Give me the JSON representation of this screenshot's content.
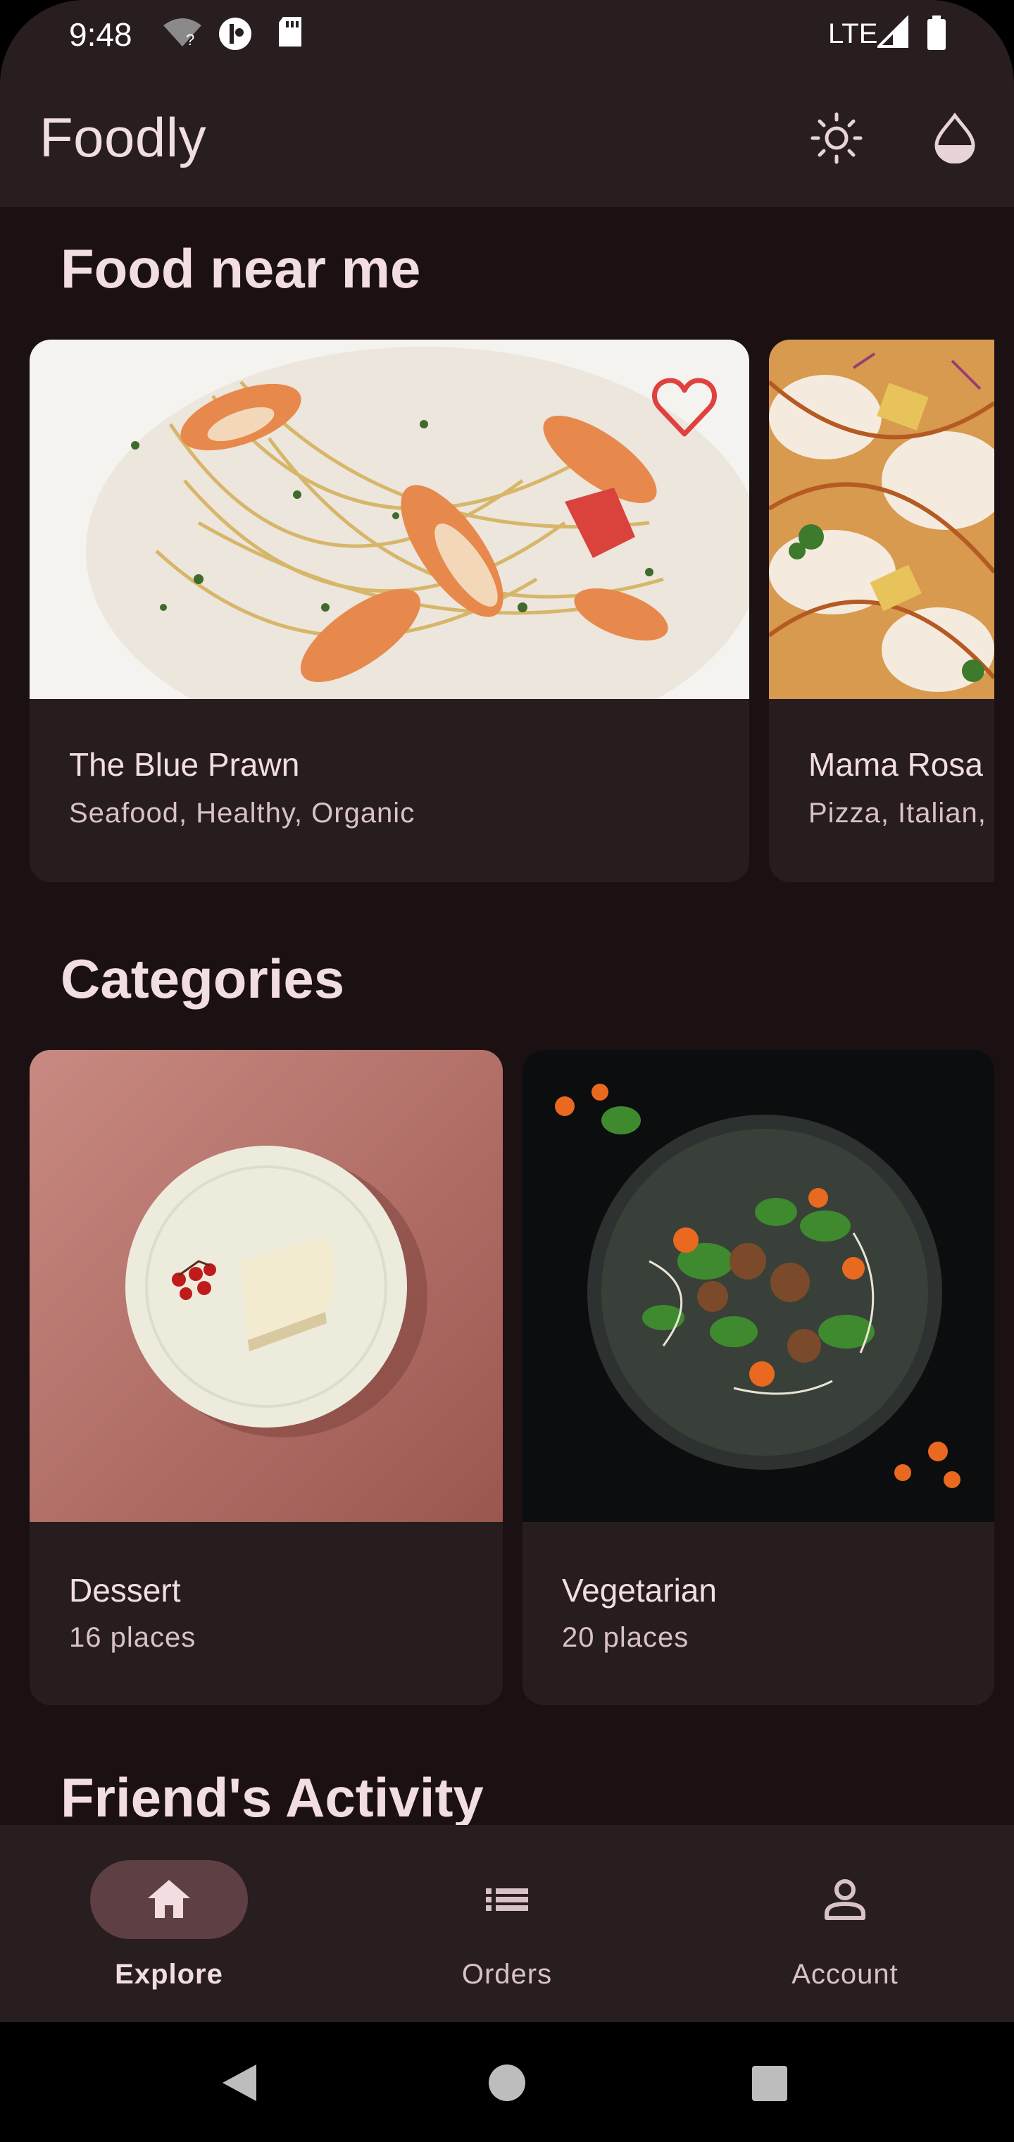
{
  "status_bar": {
    "time": "9:48",
    "network": "LTE"
  },
  "app_bar": {
    "title": "Foodly",
    "icons": [
      "brightness-icon",
      "water-drop-icon"
    ]
  },
  "sections": {
    "food_near_me": {
      "title": "Food near me",
      "restaurants": [
        {
          "name": "The Blue Prawn",
          "tags": "Seafood, Healthy, Organic",
          "favorite": true
        },
        {
          "name": "Mama Rosa",
          "tags": "Pizza, Italian,"
        }
      ]
    },
    "categories": {
      "title": "Categories",
      "items": [
        {
          "name": "Dessert",
          "count": "16 places"
        },
        {
          "name": "Vegetarian",
          "count": "20 places"
        }
      ]
    },
    "friends_activity": {
      "title": "Friend's Activity"
    }
  },
  "bottom_nav": {
    "items": [
      {
        "label": "Explore",
        "icon": "home-icon",
        "active": true
      },
      {
        "label": "Orders",
        "icon": "list-icon",
        "active": false
      },
      {
        "label": "Account",
        "icon": "person-icon",
        "active": false
      }
    ]
  },
  "colors": {
    "background": "#1b1113",
    "surface": "#271d1f",
    "on_surface": "#f2dde1",
    "active_indicator": "#5d3f44",
    "heart": "#e0413f"
  }
}
